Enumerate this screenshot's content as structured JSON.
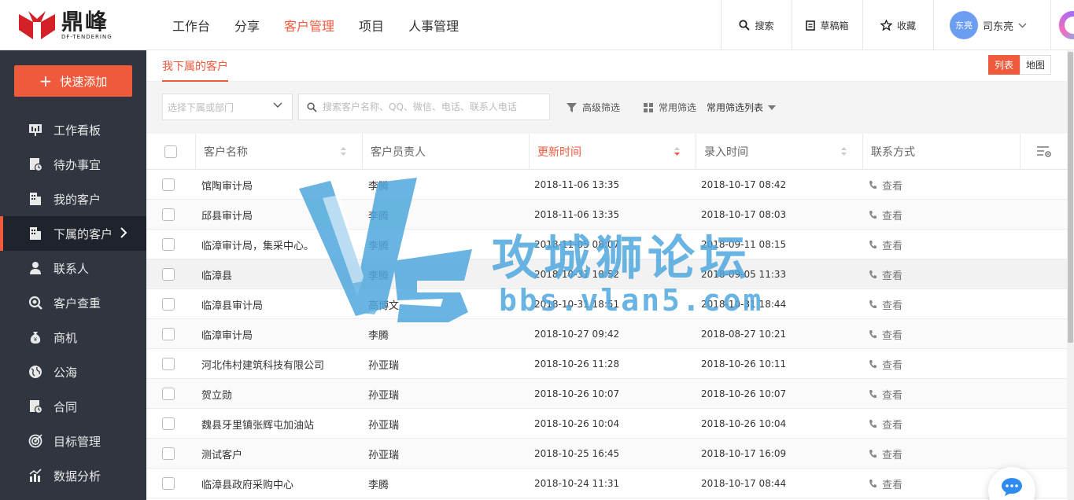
{
  "header": {
    "logo_cn": "鼎峰",
    "logo_en": "DF-TENDERING",
    "nav": [
      {
        "label": "工作台",
        "active": false
      },
      {
        "label": "分享",
        "active": false
      },
      {
        "label": "客户管理",
        "active": true
      },
      {
        "label": "项目",
        "active": false
      },
      {
        "label": "人事管理",
        "active": false
      }
    ],
    "actions": {
      "search": "搜索",
      "drafts": "草稿箱",
      "favorites": "收藏"
    },
    "user": {
      "avatar_text": "东亮",
      "name": "司东亮"
    }
  },
  "sidebar": {
    "quick_add": "快速添加",
    "items": [
      {
        "label": "工作看板",
        "icon": "dashboard-icon"
      },
      {
        "label": "待办事宜",
        "icon": "todo-icon"
      },
      {
        "label": "我的客户",
        "icon": "building-icon"
      },
      {
        "label": "下属的客户",
        "icon": "building-icon",
        "active": true
      },
      {
        "label": "联系人",
        "icon": "person-icon"
      },
      {
        "label": "客户查重",
        "icon": "search-check-icon"
      },
      {
        "label": "商机",
        "icon": "money-bag-icon"
      },
      {
        "label": "公海",
        "icon": "globe-icon"
      },
      {
        "label": "合同",
        "icon": "contract-icon"
      },
      {
        "label": "目标管理",
        "icon": "target-icon"
      },
      {
        "label": "数据分析",
        "icon": "chart-icon"
      }
    ]
  },
  "main": {
    "tab": "我下属的客户",
    "view_toggle": {
      "list": "列表",
      "map": "地图"
    },
    "filters": {
      "dept_placeholder": "选择下属或部门",
      "search_placeholder": "搜索客户名称、QQ、微信、电话、联系人电话",
      "advanced": "高级筛选",
      "common": "常用筛选",
      "common_list": "常用筛选列表"
    },
    "table": {
      "columns": [
        "客户名称",
        "客户员责人",
        "更新时间",
        "录入时间",
        "联系方式"
      ],
      "sorted_column": "更新时间",
      "rows": [
        {
          "name": "馆陶审计局",
          "owner": "李腾",
          "updated": "2018-11-06 13:35",
          "created": "2018-10-17 08:42",
          "contact": "查看"
        },
        {
          "name": "邱县审计局",
          "owner": "李腾",
          "updated": "2018-11-06 13:35",
          "created": "2018-10-17 08:03",
          "contact": "查看"
        },
        {
          "name": "临漳审计局，集采中心。",
          "owner": "李腾",
          "updated": "2018-11-05 08:07",
          "created": "2018-09-11 08:15",
          "contact": "查看"
        },
        {
          "name": "临漳县",
          "owner": "李腾",
          "updated": "2018-10-31 18:52",
          "created": "2018-09-05 11:33",
          "contact": "查看"
        },
        {
          "name": "临漳县审计局",
          "owner": "高博文",
          "updated": "2018-10-31 18:51",
          "created": "2018-10-31 18:44",
          "contact": "查看"
        },
        {
          "name": "临漳审计局",
          "owner": "李腾",
          "updated": "2018-10-27 09:42",
          "created": "2018-08-27 10:21",
          "contact": "查看"
        },
        {
          "name": "河北伟村建筑科技有限公司",
          "owner": "孙亚瑞",
          "updated": "2018-10-26 11:28",
          "created": "2018-10-26 10:11",
          "contact": "查看"
        },
        {
          "name": "贺立勋",
          "owner": "孙亚瑞",
          "updated": "2018-10-26 10:07",
          "created": "2018-10-26 10:07",
          "contact": "查看"
        },
        {
          "name": "魏县牙里镇张辉屯加油站",
          "owner": "孙亚瑞",
          "updated": "2018-10-26 10:04",
          "created": "2018-10-26 10:04",
          "contact": "查看"
        },
        {
          "name": "测试客户",
          "owner": "孙亚瑞",
          "updated": "2018-10-25 16:45",
          "created": "2018-10-17 16:09",
          "contact": "查看"
        },
        {
          "name": "临漳县政府采购中心",
          "owner": "李腾",
          "updated": "2018-10-24 11:31",
          "created": "2018-10-17 08:44",
          "contact": "查看"
        }
      ]
    }
  },
  "watermark": {
    "title": "攻城狮论坛",
    "url": "bbs.vlan5.com"
  },
  "colors": {
    "accent": "#f05a3c",
    "sidebar": "#303540",
    "watermark": "#4fa8dd"
  }
}
